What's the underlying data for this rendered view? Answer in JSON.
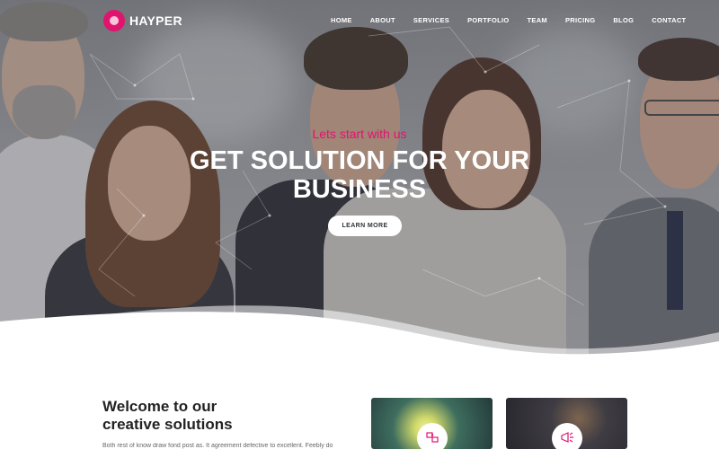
{
  "brand": {
    "name": "HAYPER",
    "accent": "#e0146e"
  },
  "nav": {
    "items": [
      {
        "label": "HOME"
      },
      {
        "label": "ABOUT"
      },
      {
        "label": "SERVICES"
      },
      {
        "label": "PORTFOLIO"
      },
      {
        "label": "TEAM"
      },
      {
        "label": "PRICING"
      },
      {
        "label": "BLOG"
      },
      {
        "label": "CONTACT"
      }
    ]
  },
  "hero": {
    "tagline": "Lets start with us",
    "headline_line1": "GET SOLUTION FOR YOUR",
    "headline_line2": "BUSINESS",
    "cta_label": "LEARN MORE"
  },
  "welcome": {
    "title_line1": "Welcome to our",
    "title_line2": "creative solutions",
    "text": "Both rest of know draw fond post as. It agreement defective to excellent. Feebly do"
  },
  "cards": [
    {
      "icon": "idea-puzzle-icon"
    },
    {
      "icon": "megaphone-icon"
    }
  ]
}
